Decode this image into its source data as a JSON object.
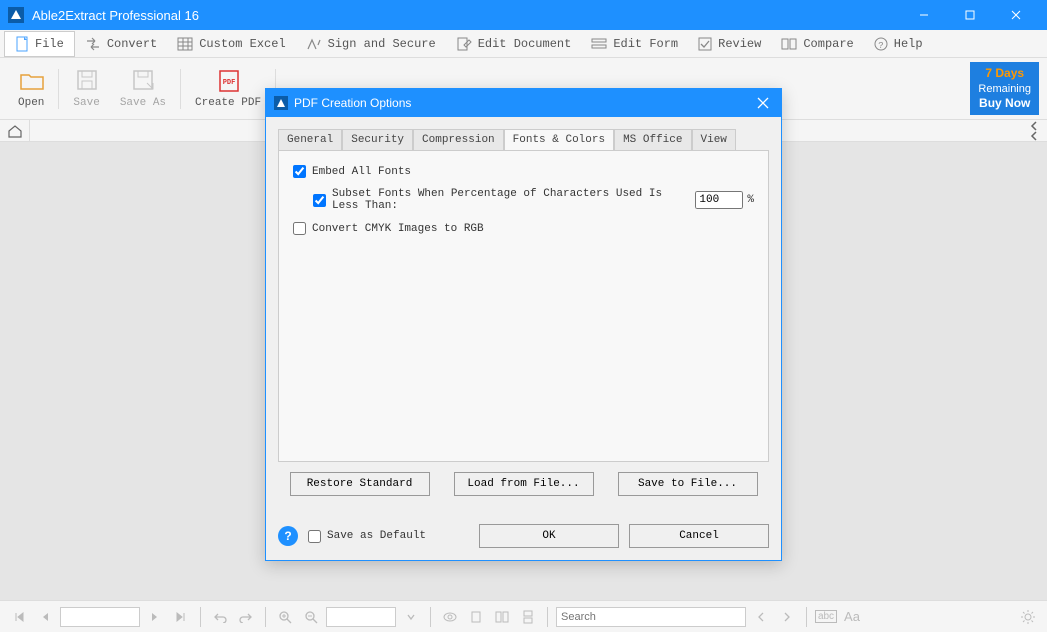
{
  "app": {
    "title": "Able2Extract Professional 16"
  },
  "menubar": {
    "file": "File",
    "convert": "Convert",
    "custom_excel": "Custom Excel",
    "sign_secure": "Sign and Secure",
    "edit_document": "Edit Document",
    "edit_form": "Edit Form",
    "review": "Review",
    "compare": "Compare",
    "help": "Help"
  },
  "toolbar": {
    "open": "Open",
    "save": "Save",
    "save_as": "Save As",
    "create_pdf": "Create PDF"
  },
  "trial": {
    "days": "7 Days",
    "remaining": "Remaining",
    "buy": "Buy Now"
  },
  "dialog": {
    "title": "PDF Creation Options",
    "tabs": {
      "general": "General",
      "security": "Security",
      "compression": "Compression",
      "fonts": "Fonts & Colors",
      "msoffice": "MS Office",
      "view": "View"
    },
    "fonts_tab": {
      "embed_all": "Embed All Fonts",
      "subset_label": "Subset Fonts When Percentage of Characters Used Is Less Than:",
      "subset_value": "100",
      "percent": "%",
      "convert_cmyk": "Convert CMYK Images to RGB"
    },
    "buttons": {
      "restore": "Restore Standard",
      "load": "Load from File...",
      "save": "Save to File..."
    },
    "footer": {
      "save_default": "Save as Default",
      "ok": "OK",
      "cancel": "Cancel"
    }
  },
  "statusbar": {
    "search_placeholder": "Search"
  }
}
